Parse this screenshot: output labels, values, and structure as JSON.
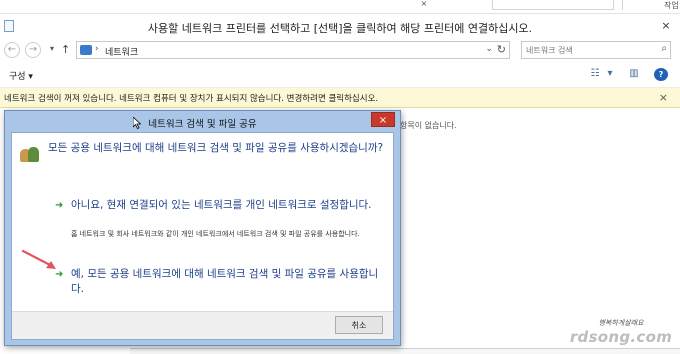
{
  "top_strip": {
    "frag_text": "작업"
  },
  "window": {
    "title": "사용할 네트워크 프린터를 선택하고 [선택]을 클릭하여 해당 프린터에 연결하십시오.",
    "close_icon": "×"
  },
  "address_bar": {
    "back": "←",
    "forward": "→",
    "up": "↑",
    "path": "네트워크",
    "search_placeholder": "네트워크 검색"
  },
  "toolbar": {
    "organize_label": "구성 ▾"
  },
  "infobar": {
    "message": "네트워크 검색이 꺼져 있습니다. 네트워크 컴퓨터 및 장치가 표시되지 않습니다. 변경하려면 클릭하십시오.",
    "close": "×"
  },
  "content": {
    "empty_text": "항목이 없습니다."
  },
  "dialog": {
    "title": "네트워크 검색 및 파일 공유",
    "close": "×",
    "question": "모든 공용 네트워크에 대해 네트워크 검색 및 파일 공유를 사용하시겠습니까?",
    "option1": {
      "main": "아니요, 현재 연결되어 있는 네트워크를 개인 네트워크로 설정합니다.",
      "sub": "홈 네트워크 및 회사 네트워크와 같이 개인 네트워크에서 네트워크 검색 및 파일 공유를 사용합니다."
    },
    "option2": {
      "main": "예, 모든 공용 네트워크에 대해 네트워크 검색 및 파일 공유를 사용합니다."
    },
    "cancel_label": "취소"
  },
  "watermark": {
    "line1": "행복하게살래요",
    "line2": "rdsong.com"
  },
  "colors": {
    "infobar_bg": "#fdf9d7",
    "dialog_frame": "#a9c6e8",
    "dialog_text": "#1b3f8a",
    "close_red": "#c8392c",
    "green_arrow": "#2f9a2f"
  }
}
